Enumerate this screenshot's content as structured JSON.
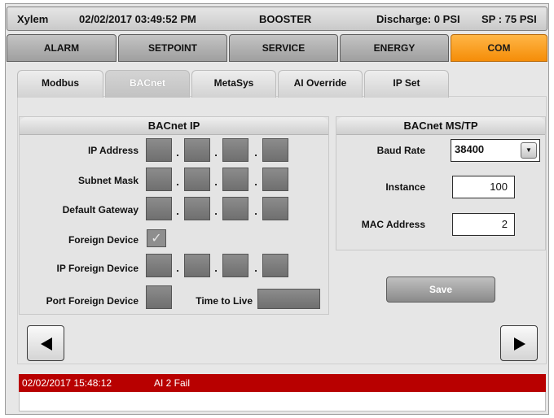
{
  "header": {
    "brand": "Xylem",
    "datetime": "02/02/2017 03:49:52 PM",
    "mode": "BOOSTER",
    "discharge": "Discharge: 0 PSI",
    "setpoint": "SP : 75 PSI"
  },
  "main_tabs": [
    {
      "label": "ALARM",
      "active": false
    },
    {
      "label": "SETPOINT",
      "active": false
    },
    {
      "label": "SERVICE",
      "active": false
    },
    {
      "label": "ENERGY",
      "active": false
    },
    {
      "label": "COM",
      "active": true
    }
  ],
  "sub_tabs": [
    {
      "label": "Modbus",
      "active": false
    },
    {
      "label": "BACnet",
      "active": true
    },
    {
      "label": "MetaSys",
      "active": false
    },
    {
      "label": "AI Override",
      "active": false
    },
    {
      "label": "IP Set",
      "active": false
    }
  ],
  "bacnet_ip": {
    "title": "BACnet IP",
    "ip_address_label": "IP Address",
    "subnet_mask_label": "Subnet Mask",
    "default_gateway_label": "Default Gateway",
    "foreign_device_label": "Foreign Device",
    "foreign_device_checked": true,
    "ip_foreign_device_label": "IP Foreign Device",
    "port_foreign_device_label": "Port Foreign Device",
    "time_to_live_label": "Time to Live",
    "octet_separator": "."
  },
  "bacnet_mstp": {
    "title": "BACnet MS/TP",
    "baud_rate_label": "Baud Rate",
    "baud_rate_value": "38400",
    "instance_label": "Instance",
    "instance_value": "100",
    "mac_address_label": "MAC Address",
    "mac_address_value": "2"
  },
  "buttons": {
    "save_label": "Save",
    "prev_icon": "left-triangle-icon",
    "next_icon": "right-triangle-icon"
  },
  "alarm": {
    "timestamp": "02/02/2017 15:48:12",
    "message": "AI 2 Fail",
    "color": "#b80000"
  },
  "colors": {
    "active_tab": "#f58d08",
    "field_gray": "#7d7d7d"
  }
}
